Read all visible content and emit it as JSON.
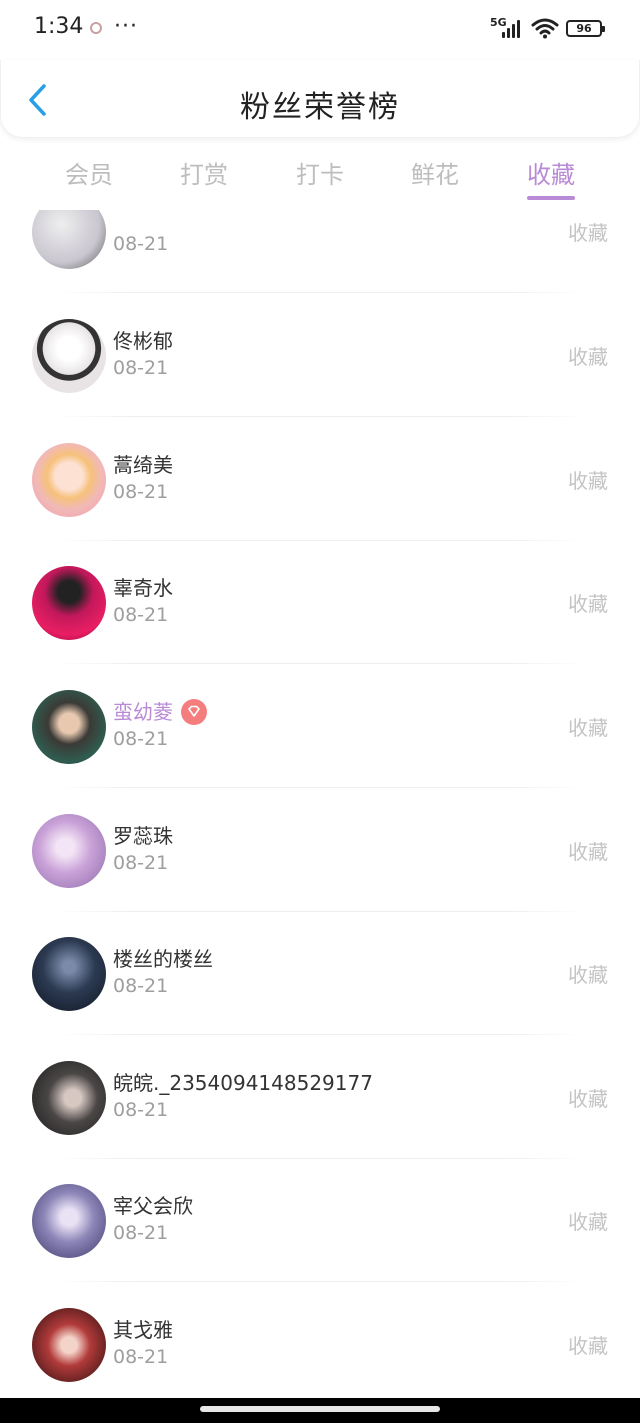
{
  "status_bar": {
    "time": "1:34",
    "more": "···",
    "network": "5G",
    "battery": "96"
  },
  "header": {
    "title": "粉丝荣誉榜",
    "back_icon": "chevron-left-icon",
    "accent": "#29a0e6"
  },
  "tabs": [
    {
      "label": "会员",
      "active": false
    },
    {
      "label": "打赏",
      "active": false
    },
    {
      "label": "打卡",
      "active": false
    },
    {
      "label": "鲜花",
      "active": false
    },
    {
      "label": "收藏",
      "active": true
    }
  ],
  "colors": {
    "accent_purple": "#b98ad6",
    "inactive_text": "#bdbdbd",
    "vip_badge": "#f47e7e"
  },
  "list": [
    {
      "name": "",
      "date": "08-21",
      "action": "收藏",
      "vip": false,
      "avatar_color": "#c9c6cf"
    },
    {
      "name": "佟彬郁",
      "date": "08-21",
      "action": "收藏",
      "vip": false,
      "avatar_color": "#e8e4e6"
    },
    {
      "name": "蒿绮美",
      "date": "08-21",
      "action": "收藏",
      "vip": false,
      "avatar_color": "#f1b9b7"
    },
    {
      "name": "辜奇水",
      "date": "08-21",
      "action": "收藏",
      "vip": false,
      "avatar_color": "#c2185b"
    },
    {
      "name": "蛮幼菱",
      "date": "08-21",
      "action": "收藏",
      "vip": true,
      "avatar_color": "#3b3a36"
    },
    {
      "name": "罗蕊珠",
      "date": "08-21",
      "action": "收藏",
      "vip": false,
      "avatar_color": "#c9a2d8"
    },
    {
      "name": "楼丝的楼丝",
      "date": "08-21",
      "action": "收藏",
      "vip": false,
      "avatar_color": "#2c3a52"
    },
    {
      "name": "皖皖._2354094148529177",
      "date": "08-21",
      "action": "收藏",
      "vip": false,
      "avatar_color": "#4a4646"
    },
    {
      "name": "宰父会欣",
      "date": "08-21",
      "action": "收藏",
      "vip": false,
      "avatar_color": "#8d86b8"
    },
    {
      "name": "其戈雅",
      "date": "08-21",
      "action": "收藏",
      "vip": false,
      "avatar_color": "#7a2a2a"
    }
  ]
}
